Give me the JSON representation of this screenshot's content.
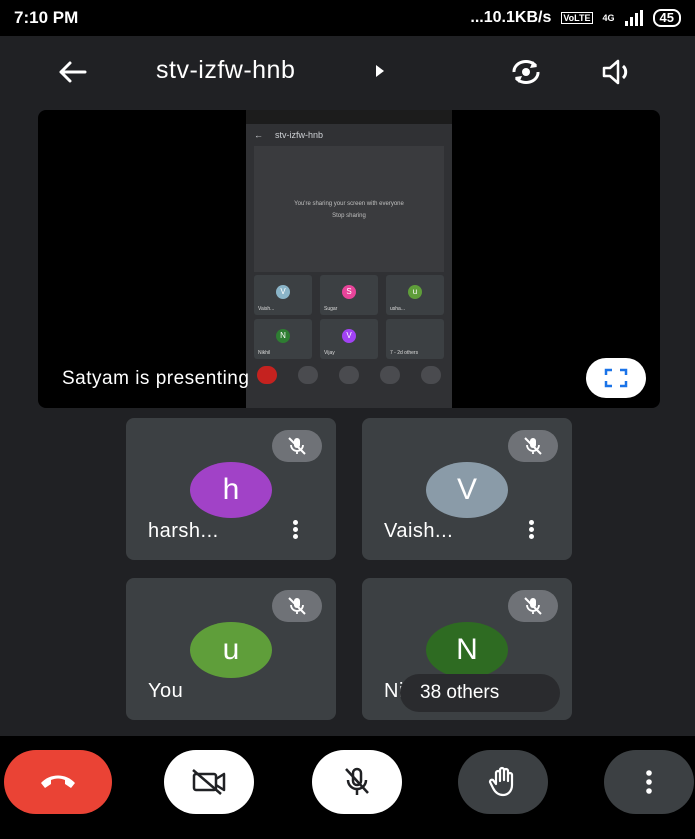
{
  "status_bar": {
    "time": "7:10 PM",
    "net_speed": "...10.1KB/s",
    "network": "4G",
    "volte": "VoLTE",
    "battery": "45"
  },
  "header": {
    "meeting_code": "stv-izfw-hnb"
  },
  "presentation": {
    "label": "Satyam is presenting",
    "preview": {
      "title": "stv-izfw-hnb",
      "sharing_text": "You're sharing your screen with everyone",
      "stop_label": "Stop sharing",
      "tiles": [
        {
          "initial": "V",
          "name": "Vaish...",
          "color": "#8ab4c8"
        },
        {
          "initial": "S",
          "name": "Sugar",
          "color": "#e8449a"
        },
        {
          "initial": "u",
          "name": "usha...",
          "color": "#5f9e3a"
        },
        {
          "initial": "N",
          "name": "Nikhil",
          "color": "#2e7d32"
        },
        {
          "initial": "V",
          "name": "Vijay",
          "color": "#a142f4"
        },
        {
          "initial": "",
          "name": "7 - 2d others",
          "color": "#3c4043"
        }
      ]
    }
  },
  "participants": [
    {
      "initial": "h",
      "name": "harsh...",
      "avatar_color": "#a142c7"
    },
    {
      "initial": "V",
      "name": "Vaish...",
      "avatar_color": "#8a9ba8"
    },
    {
      "initial": "u",
      "name": "You",
      "avatar_color": "#5f9e3a"
    },
    {
      "initial": "N",
      "name": "Nikhil",
      "avatar_color": "#2e6b22"
    }
  ],
  "others": {
    "label": "38 others"
  },
  "controls": {
    "end_call": "end-call",
    "camera": "camera-off",
    "microphone": "mic-off",
    "raise_hand": "raise-hand",
    "more": "more-options"
  },
  "colors": {
    "end_call": "#ea4335",
    "accent_blue": "#1a73e8",
    "tile_bg": "#3c4043",
    "background": "#202124"
  }
}
